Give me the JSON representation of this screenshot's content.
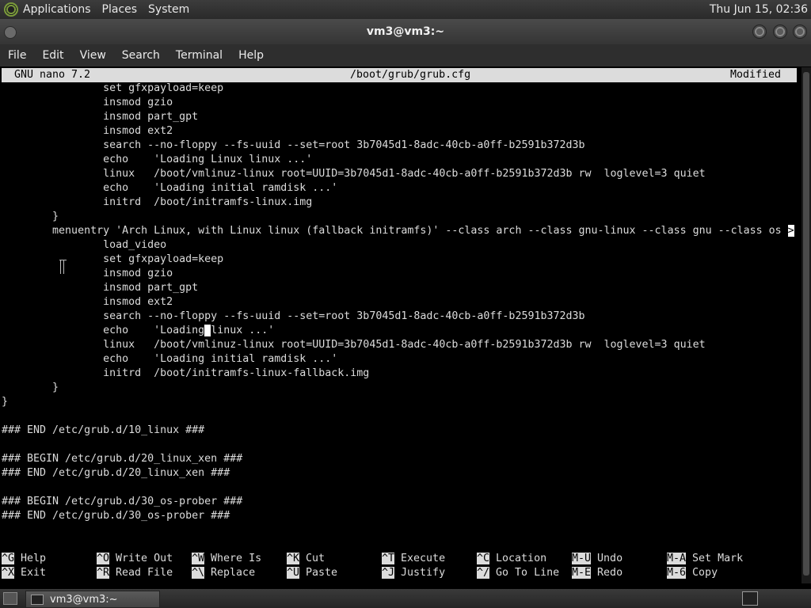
{
  "top_panel": {
    "menus": [
      "Applications",
      "Places",
      "System"
    ],
    "clock": "Thu Jun 15, 02:36"
  },
  "window": {
    "title": "vm3@vm3:~"
  },
  "menubar": [
    "File",
    "Edit",
    "View",
    "Search",
    "Terminal",
    "Help"
  ],
  "nano": {
    "version": "GNU nano 7.2",
    "filename": "/boot/grub/grub.cfg",
    "status": "Modified",
    "lines": [
      "                set gfxpayload=keep",
      "                insmod gzio",
      "                insmod part_gpt",
      "                insmod ext2",
      "                search --no-floppy --fs-uuid --set=root 3b7045d1-8adc-40cb-a0ff-b2591b372d3b",
      "                echo    'Loading Linux linux ...'",
      "                linux   /boot/vmlinuz-linux root=UUID=3b7045d1-8adc-40cb-a0ff-b2591b372d3b rw  loglevel=3 quiet",
      "                echo    'Loading initial ramdisk ...'",
      "                initrd  /boot/initramfs-linux.img",
      "        }",
      "        menuentry 'Arch Linux, with Linux linux (fallback initramfs)' --class arch --class gnu-linux --class gnu --class os ",
      "                load_video",
      "                set gfxpayload=keep",
      "                insmod gzio",
      "                insmod part_gpt",
      "                insmod ext2",
      "                search --no-floppy --fs-uuid --set=root 3b7045d1-8adc-40cb-a0ff-b2591b372d3b",
      "                echo    'Loading",
      "                linux   /boot/vmlinuz-linux root=UUID=3b7045d1-8adc-40cb-a0ff-b2591b372d3b rw  loglevel=3 quiet",
      "                echo    'Loading initial ramdisk ...'",
      "                initrd  /boot/initramfs-linux-fallback.img",
      "        }",
      "}",
      "",
      "### END /etc/grub.d/10_linux ###",
      "",
      "### BEGIN /etc/grub.d/20_linux_xen ###",
      "### END /etc/grub.d/20_linux_xen ###",
      "",
      "### BEGIN /etc/grub.d/30_os-prober ###",
      "### END /etc/grub.d/30_os-prober ###"
    ],
    "line10_overflow": ">",
    "line17_after_cursor": "linux ...'",
    "shortcuts": [
      {
        "key": "^G",
        "label": "Help"
      },
      {
        "key": "^O",
        "label": "Write Out"
      },
      {
        "key": "^W",
        "label": "Where Is"
      },
      {
        "key": "^K",
        "label": "Cut"
      },
      {
        "key": "^T",
        "label": "Execute"
      },
      {
        "key": "^C",
        "label": "Location"
      },
      {
        "key": "M-U",
        "label": "Undo"
      },
      {
        "key": "M-A",
        "label": "Set Mark"
      },
      {
        "key": "^X",
        "label": "Exit"
      },
      {
        "key": "^R",
        "label": "Read File"
      },
      {
        "key": "^\\",
        "label": "Replace"
      },
      {
        "key": "^U",
        "label": "Paste"
      },
      {
        "key": "^J",
        "label": "Justify"
      },
      {
        "key": "^/",
        "label": "Go To Line"
      },
      {
        "key": "M-E",
        "label": "Redo"
      },
      {
        "key": "M-6",
        "label": "Copy"
      }
    ]
  },
  "taskbar": {
    "task_label": "vm3@vm3:~"
  }
}
